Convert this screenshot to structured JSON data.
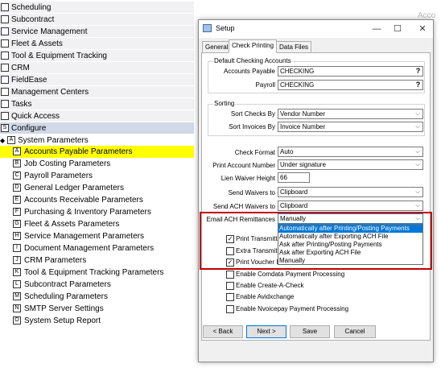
{
  "nav": {
    "items": [
      {
        "label": "Scheduling",
        "box": ""
      },
      {
        "label": "Subcontract",
        "box": ""
      },
      {
        "label": "Service Management",
        "box": ""
      },
      {
        "label": "Fleet & Assets",
        "box": ""
      },
      {
        "label": "Tool & Equipment Tracking",
        "box": ""
      },
      {
        "label": "CRM",
        "box": ""
      },
      {
        "label": "FieldEase",
        "box": ""
      },
      {
        "label": "Management Centers",
        "box": ""
      },
      {
        "label": "Tasks",
        "box": ""
      },
      {
        "label": "Quick Access",
        "box": ""
      },
      {
        "label": "Configure",
        "box": "S"
      }
    ],
    "system_parameters": {
      "label": "System Parameters",
      "box": "A"
    },
    "sub_items": [
      {
        "label": "Accounts Payable Parameters",
        "box": "A"
      },
      {
        "label": "Job Costing Parameters",
        "box": "B"
      },
      {
        "label": "Payroll Parameters",
        "box": "C"
      },
      {
        "label": "General Ledger Parameters",
        "box": "D"
      },
      {
        "label": "Accounts Receivable Parameters",
        "box": "E"
      },
      {
        "label": "Purchasing & Inventory Parameters",
        "box": "F"
      },
      {
        "label": "Fleet & Assets Parameters",
        "box": "G"
      },
      {
        "label": "Service Management Parameters",
        "box": "H"
      },
      {
        "label": "Document Management Parameters",
        "box": "I"
      },
      {
        "label": "CRM Parameters",
        "box": "J"
      },
      {
        "label": "Tool & Equipment Tracking Parameters",
        "box": "K"
      },
      {
        "label": "Subcontract Parameters",
        "box": "L"
      },
      {
        "label": "Scheduling Parameters",
        "box": "M"
      },
      {
        "label": "SMTP Server Settings",
        "box": "N"
      },
      {
        "label": "System Setup Report",
        "box": "O"
      }
    ]
  },
  "background": {
    "title_fragment": "Acco"
  },
  "dialog": {
    "title": "Setup",
    "window_buttons": {
      "minimize": "—",
      "maximize": "☐",
      "close": "✕"
    },
    "tabs": [
      "General",
      "Check Printing",
      "Data Files"
    ],
    "default_checking": {
      "caption": "Default Checking Accounts",
      "accounts_payable_label": "Accounts Payable",
      "accounts_payable_value": "CHECKING",
      "payroll_label": "Payroll",
      "payroll_value": "CHECKING",
      "lookup_glyph": "?"
    },
    "sorting": {
      "caption": "Sorting",
      "sort_checks_label": "Sort Checks By",
      "sort_checks_value": "Vendor Number",
      "sort_invoices_label": "Sort Invoices By",
      "sort_invoices_value": "Invoice Number"
    },
    "fields": {
      "check_format_label": "Check Format",
      "check_format_value": "Auto",
      "print_account_number_label": "Print Account Number",
      "print_account_number_value": "Under signature",
      "lien_waiver_height_label": "Lien Waiver Height",
      "lien_waiver_height_value": "66",
      "send_waivers_label": "Send Waivers to",
      "send_waivers_value": "Clipboard",
      "send_ach_waivers_label": "Send ACH Waivers to",
      "send_ach_waivers_value": "Clipboard",
      "email_ach_label": "Email ACH Remittances",
      "email_ach_value": "Manually",
      "dropdown_arrow": "⌵"
    },
    "email_ach_options": [
      "Automatically after Printing/Posting Payments",
      "Automatically after Exporting ACH File",
      "Ask after Printing/Posting Payments",
      "Ask after Exporting ACH File",
      "Manually"
    ],
    "checkboxes": [
      {
        "label": "Print Transmitt",
        "checked": true
      },
      {
        "label": "Extra Transmitt",
        "checked": false
      },
      {
        "label": "Print Voucher I",
        "checked": true
      },
      {
        "label": "Enable Comdata Payment Processing",
        "checked": false
      },
      {
        "label": "Enable Create-A-Check",
        "checked": false
      },
      {
        "label": "Enable Avidxchange",
        "checked": false
      },
      {
        "label": "Enable Nvoicepay Payment Processing",
        "checked": false
      }
    ],
    "check_glyph": "✓",
    "buttons": {
      "back": "< Back",
      "next": "Next >",
      "save": "Save",
      "cancel": "Cancel"
    }
  }
}
